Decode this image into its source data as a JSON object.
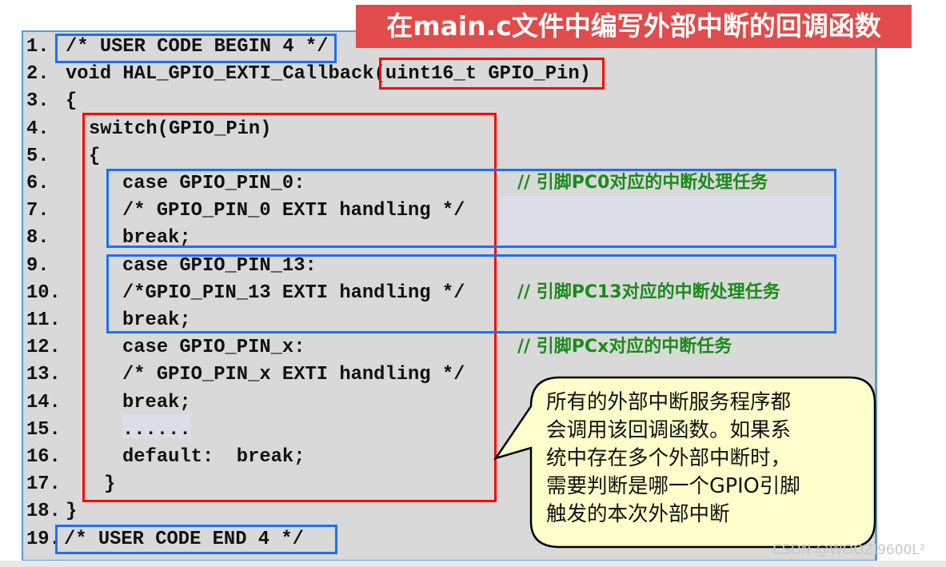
{
  "title": "在main.c文件中编写外部中断的回调函数",
  "code_lines": [
    {
      "num": "1.",
      "code": "/* USER CODE BEGIN 4 */"
    },
    {
      "num": "2.",
      "code": "void HAL_GPIO_EXTI_Callback(uint16_t GPIO_Pin)"
    },
    {
      "num": "3.",
      "code": "{"
    },
    {
      "num": "4.",
      "code": "switch(GPIO_Pin)"
    },
    {
      "num": "5.",
      "code": "{"
    },
    {
      "num": "6.",
      "code": "case GPIO_PIN_0:"
    },
    {
      "num": "7.",
      "code": "/* GPIO_PIN_0 EXTI handling */"
    },
    {
      "num": "8.",
      "code": "break;"
    },
    {
      "num": "9.",
      "code": "case GPIO_PIN_13:"
    },
    {
      "num": "10.",
      "code": "/*GPIO_PIN_13 EXTI handling */"
    },
    {
      "num": "11.",
      "code": "break;"
    },
    {
      "num": "12.",
      "code": "case GPIO_PIN_x:"
    },
    {
      "num": "13.",
      "code": "/* GPIO_PIN_x EXTI handling */"
    },
    {
      "num": "14.",
      "code": "break;"
    },
    {
      "num": "15.",
      "code": "......"
    },
    {
      "num": "16.",
      "code": "default:  break;"
    },
    {
      "num": "17.",
      "code": "}"
    },
    {
      "num": "18.",
      "code": "}"
    },
    {
      "num": "19.",
      "code": "/* USER CODE END 4 */"
    }
  ],
  "comments": {
    "line6": "// 引脚PC0对应的中断处理任务",
    "line10": "// 引脚PC13对应的中断处理任务",
    "line12": "// 引脚PCx对应的中断任务"
  },
  "callout_lines": [
    "所有的外部中断服务程序都",
    "会调用该回调函数。如果系",
    "统中存在多个外部中断时，",
    "需要判断是哪一个GPIO引脚",
    "触发的本次外部中断"
  ],
  "watermark": "CSDN @WOOZI9600L²",
  "colors": {
    "title_bg": "#e24b4b",
    "comment": "#1b8a1b",
    "box_blue": "#1a6fff",
    "box_red": "#ff0000",
    "callout_bg": "#ffffcc",
    "panel_bg": "#d9d9d9"
  }
}
